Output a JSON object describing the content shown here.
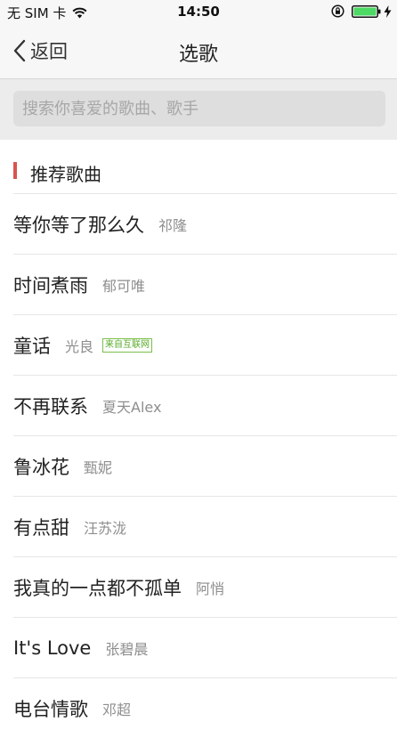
{
  "status_bar": {
    "carrier": "无 SIM 卡",
    "time": "14:50"
  },
  "nav": {
    "back_label": "返回",
    "title": "选歌"
  },
  "search": {
    "placeholder": "搜索你喜爱的歌曲、歌手",
    "value": ""
  },
  "section": {
    "title": "推荐歌曲"
  },
  "songs": [
    {
      "title": "等你等了那么久",
      "artist": "祁隆"
    },
    {
      "title": "时间煮雨",
      "artist": "郁可唯"
    },
    {
      "title": "童话",
      "artist": "光良",
      "tag": "来自互联网"
    },
    {
      "title": "不再联系",
      "artist": "夏天Alex"
    },
    {
      "title": "鲁冰花",
      "artist": "甄妮"
    },
    {
      "title": "有点甜",
      "artist": "汪苏泷"
    },
    {
      "title": "我真的一点都不孤单",
      "artist": "阿悄"
    },
    {
      "title": "It's Love",
      "artist": "张碧晨"
    },
    {
      "title": "电台情歌",
      "artist": "邓超"
    }
  ],
  "colors": {
    "accent": "#d9534f",
    "battery": "#4cd964",
    "tag": "#5aaa2b"
  }
}
